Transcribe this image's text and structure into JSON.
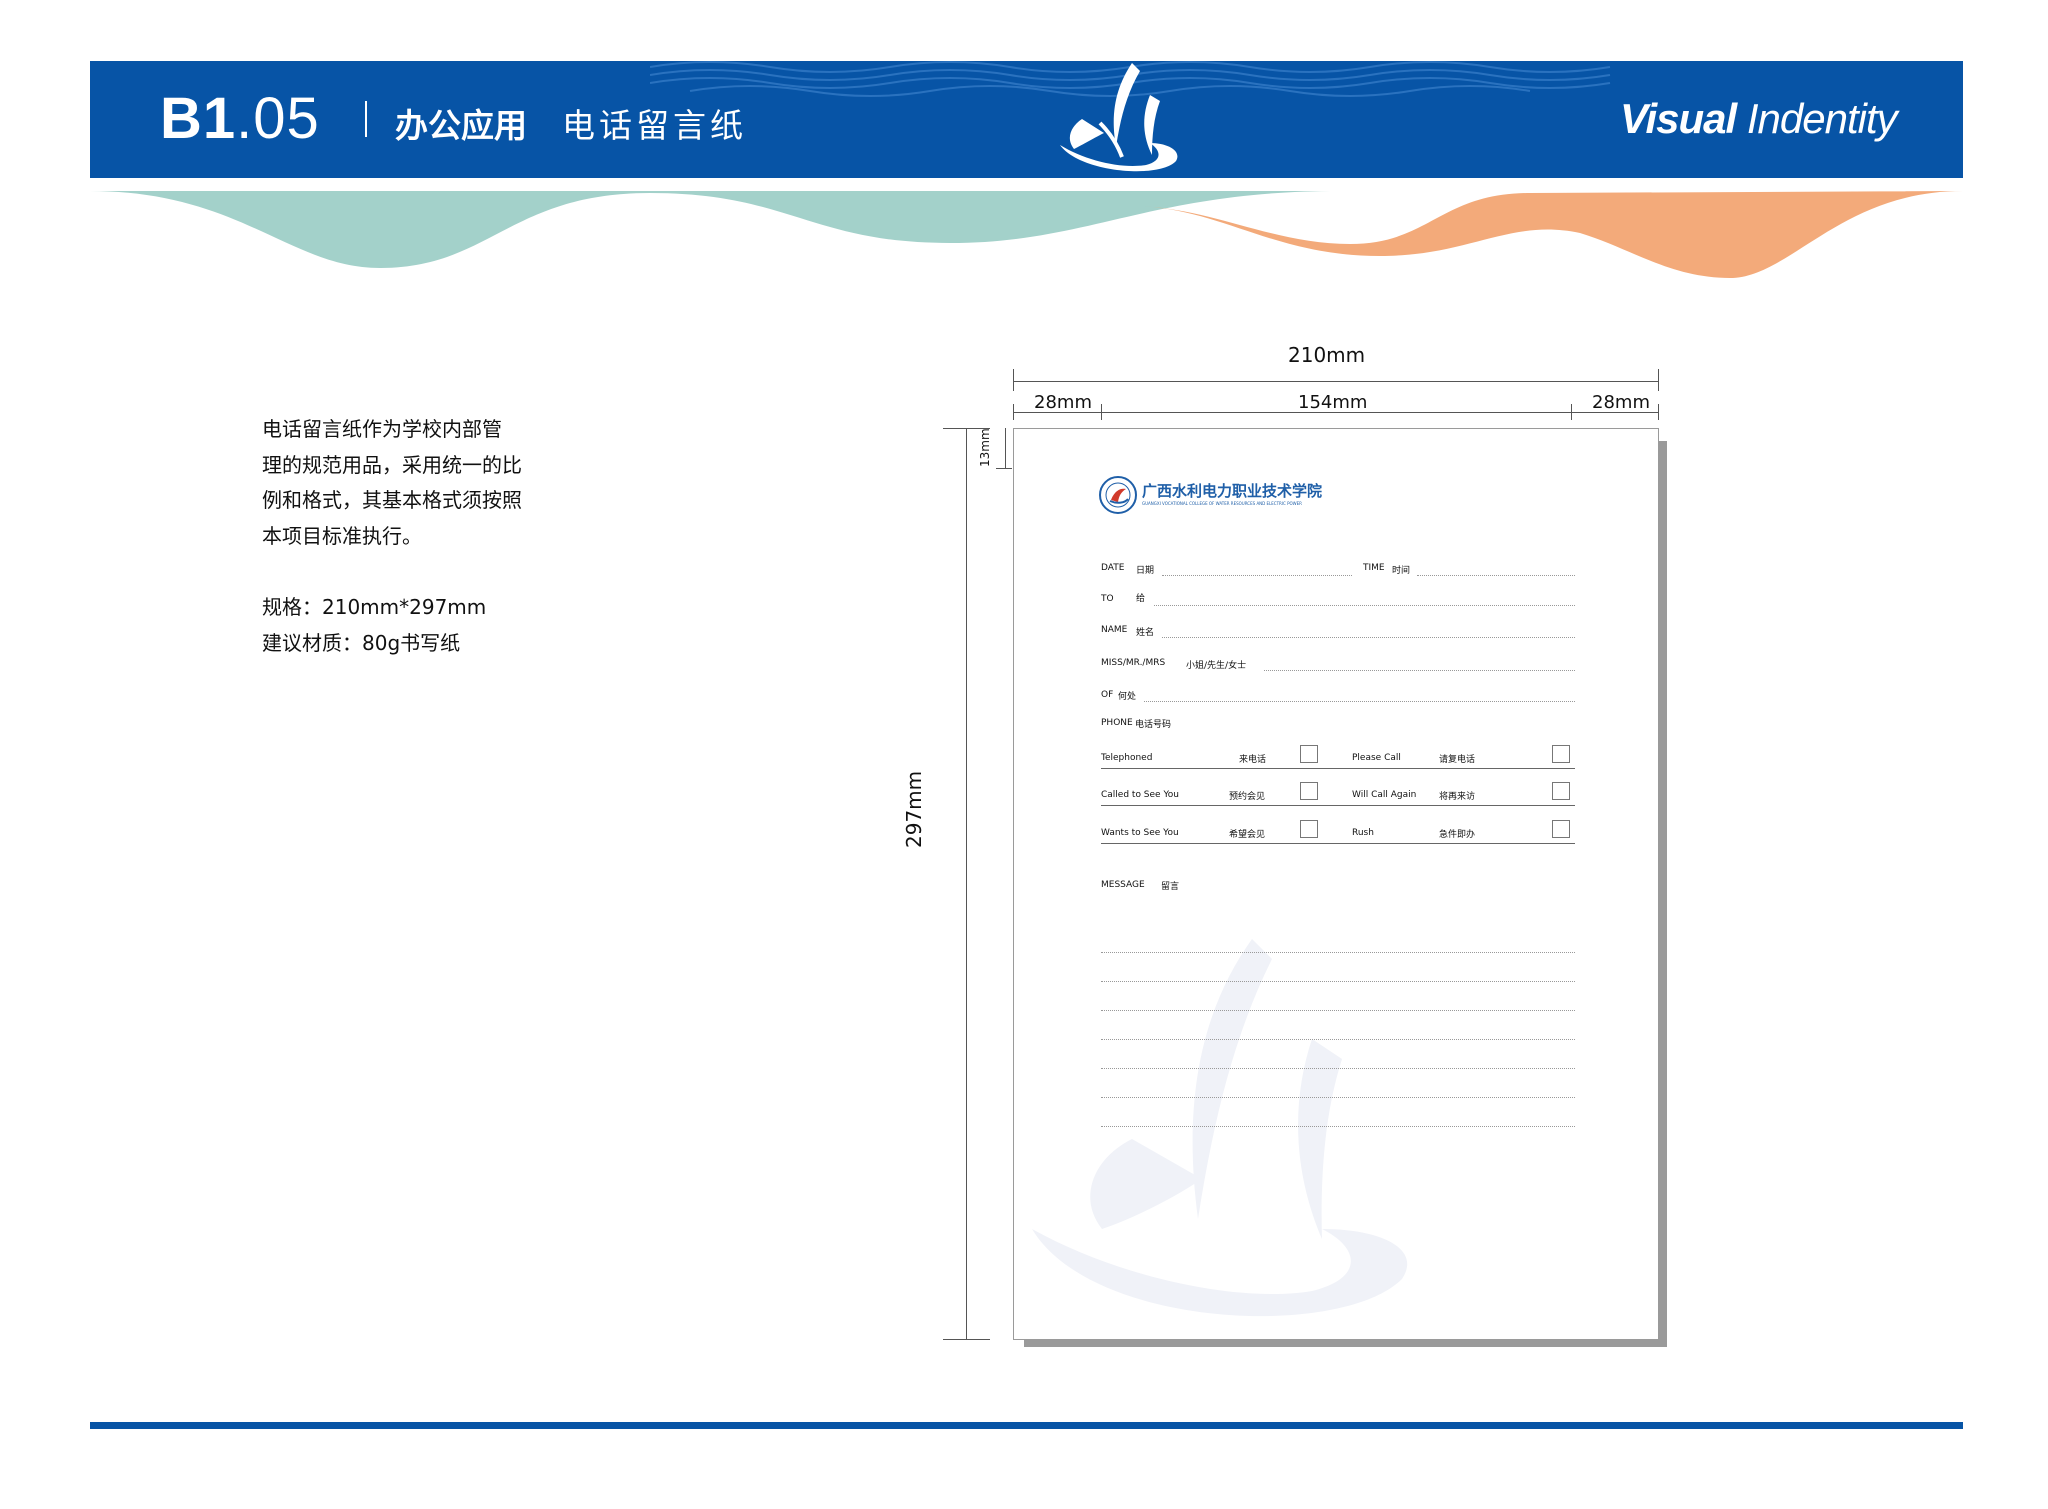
{
  "header": {
    "code_major": "B1",
    "code_minor": ".05",
    "section": "办公应用",
    "subject": "电话留言纸",
    "brand_bold": "Visual",
    "brand_rest": " Indentity"
  },
  "description": {
    "paragraph": [
      "电话留言纸作为学校内部管",
      "理的规范用品，采用统一的比",
      "例和格式，其基本格式须按照",
      "本项目标准执行。"
    ],
    "spec": "规格：210mm*297mm",
    "material": "建议材质：80g书写纸"
  },
  "dimensions": {
    "width": "210mm",
    "left_margin": "28mm",
    "content": "154mm",
    "right_margin": "28mm",
    "height": "297mm",
    "top_margin": "13mm"
  },
  "paper": {
    "school_name": "广西水利电力职业技术学院",
    "school_name_en": "GUANGXI VOCATIONAL COLLEGE OF WATER RESOURCES AND ELECTRIC POWER",
    "fields": {
      "date_en": "DATE",
      "date_cn": "日期",
      "time_en": "TIME",
      "time_cn": "时间",
      "to_en": "TO",
      "to_cn": "给",
      "name_en": "NAME",
      "name_cn": "姓名",
      "miss_en": "MISS/MR./MRS",
      "miss_cn": "小姐/先生/女士",
      "of_en": "OF",
      "of_cn": "何处",
      "phone_en": "PHONE",
      "phone_cn": "电话号码"
    },
    "checks": {
      "r1_left_en": "Telephoned",
      "r1_left_cn": "来电话",
      "r1_right_en": "Please Call",
      "r1_right_cn": "请复电话",
      "r2_left_en": "Called to See You",
      "r2_left_cn": "预约会见",
      "r2_right_en": "Will Call Again",
      "r2_right_cn": "将再来访",
      "r3_left_en": "Wants to See You",
      "r3_left_cn": "希望会见",
      "r3_right_en": "Rush",
      "r3_right_cn": "急件即办"
    },
    "message_en": "MESSAGE",
    "message_cn": "留言"
  },
  "colors": {
    "brand_blue": "#0754a6",
    "wave_teal": "#a3d1ca",
    "wave_orange": "#f3aa7a"
  }
}
